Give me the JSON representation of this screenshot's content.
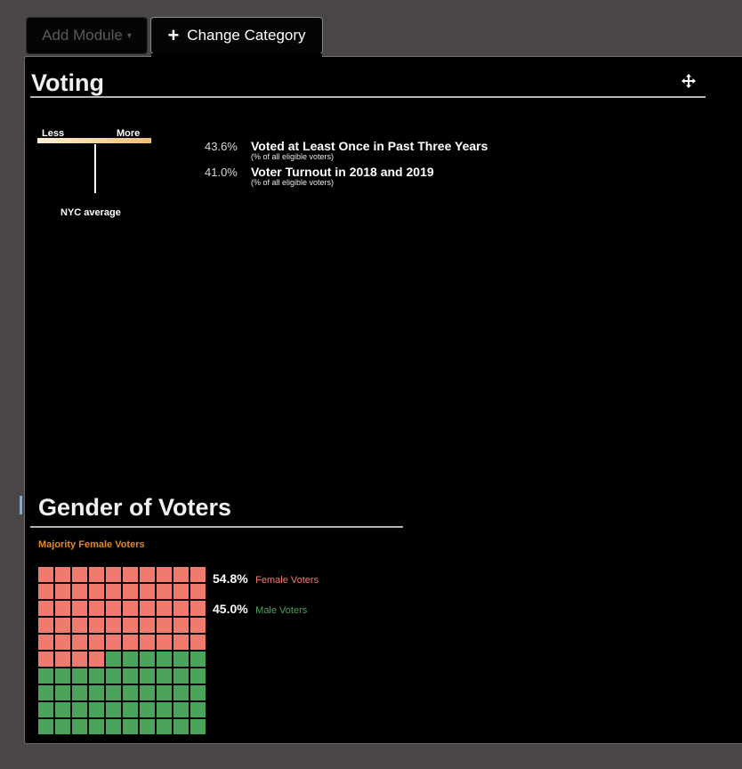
{
  "toolbar": {
    "add_module_label": "Add Module",
    "change_category_label": "Change Category"
  },
  "voting": {
    "title": "Voting",
    "scale": {
      "less": "Less",
      "more": "More",
      "average_label": "NYC average"
    },
    "metrics": [
      {
        "value": "43.6%",
        "label": "Voted at Least Once in Past Three Years",
        "sub": "(% of all eligible voters)"
      },
      {
        "value": "41.0%",
        "label": "Voter Turnout in 2018 and 2019",
        "sub": "(% of all eligible voters)"
      }
    ]
  },
  "gender": {
    "title": "Gender of Voters",
    "summary": "Majority Female Voters",
    "female": {
      "pct": "54.8%",
      "label": "Female Voters",
      "color": "#f07a6e",
      "cells": 54
    },
    "male": {
      "pct": "45.0%",
      "label": "Male Voters",
      "color": "#4aa45a",
      "cells": 46
    }
  },
  "colors": {
    "background": "#4a4646",
    "panel": "#000000",
    "accent_orange": "#e0862a",
    "female": "#f07a6e",
    "male": "#4aa45a"
  },
  "icons": {
    "move": "move-arrows-icon",
    "plus": "plus-icon",
    "caret": "caret-down-icon"
  }
}
